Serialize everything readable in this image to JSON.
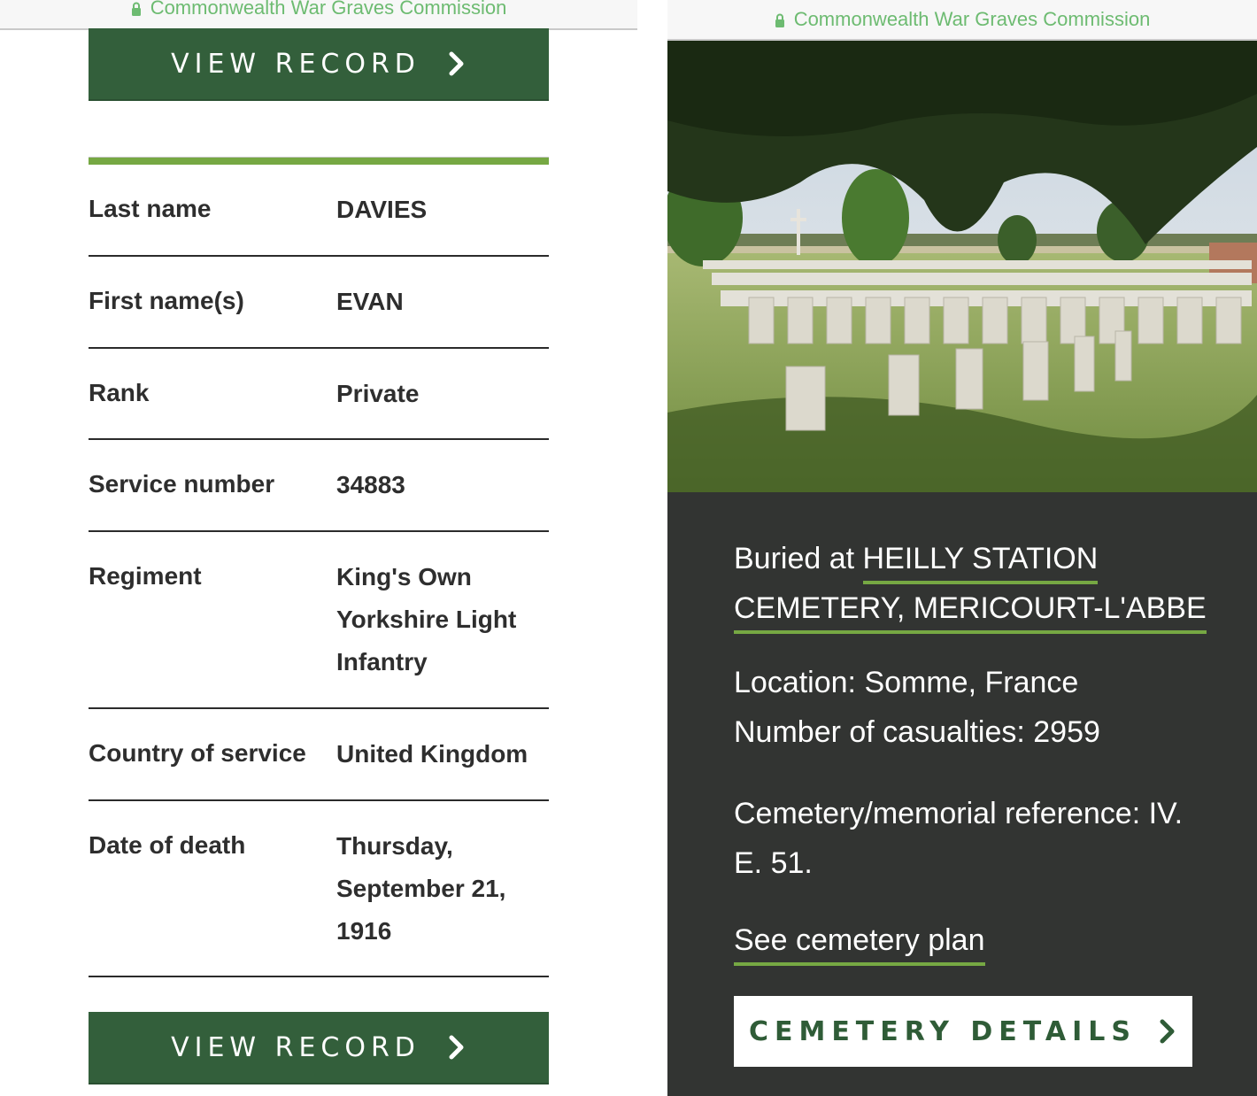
{
  "browser": {
    "site_title": "Commonwealth War Graves Commission",
    "lock_icon": "lock-icon",
    "accent_color": "#6dbb71"
  },
  "record": {
    "view_record_label": "VIEW RECORD",
    "chevron_icon": "chevron-right-icon",
    "brand_green": "#335f3b",
    "accent_green": "#76a843",
    "fields": [
      {
        "label": "Last name",
        "value": "DAVIES"
      },
      {
        "label": "First name(s)",
        "value": "EVAN"
      },
      {
        "label": "Rank",
        "value": "Private"
      },
      {
        "label": "Service number",
        "value": "34883"
      },
      {
        "label": "Regiment",
        "value": "King's Own Yorkshire Light Infantry"
      },
      {
        "label": "Country of service",
        "value": "United Kingdom"
      },
      {
        "label": "Date of death",
        "value": "Thursday, September 21, 1916"
      }
    ]
  },
  "cemetery": {
    "photo_alt": "Rows of white headstones in a cemetery under tree shade",
    "buried_prefix": "Buried at ",
    "cemetery_name_line1": "HEILLY STATION",
    "cemetery_name_line2": "CEMETERY, MERICOURT-L'ABBE",
    "location": "Location: Somme, France",
    "casualties": "Number of casualties: 2959",
    "reference_line1": "Cemetery/memorial reference: IV.",
    "reference_line2": "E. 51.",
    "plan_link": "See cemetery plan",
    "details_button": "CEMETERY DETAILS",
    "panel_bg": "#323432"
  }
}
